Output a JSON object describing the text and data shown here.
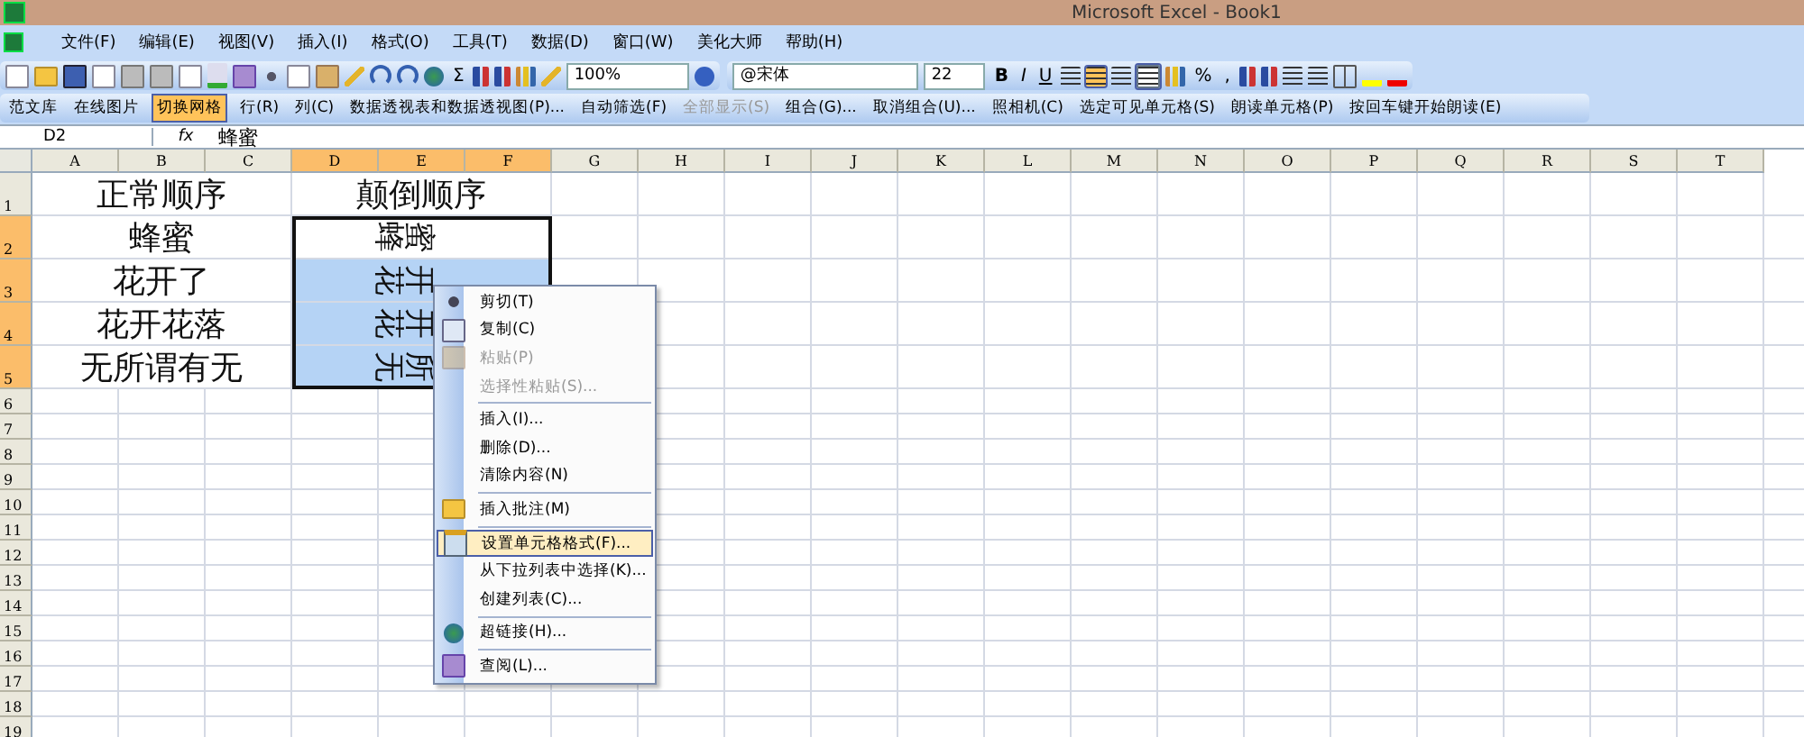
{
  "window": {
    "title": "Microsoft Excel - Book1"
  },
  "menu_bar": [
    "文件(F)",
    "编辑(E)",
    "视图(V)",
    "插入(I)",
    "格式(O)",
    "工具(T)",
    "数据(D)",
    "窗口(W)",
    "美化大师",
    "帮助(H)"
  ],
  "standard_toolbar": {
    "sum": "Σ",
    "zoom": "100%"
  },
  "formatting_toolbar": {
    "font": "@宋体",
    "size": "22",
    "bold": "B",
    "italic": "I",
    "underline": "U",
    "percent": "%",
    "comma": ",",
    "alignment": [
      {
        "selected": false
      },
      {
        "selected": true
      },
      {
        "selected": false
      }
    ],
    "merge_center": {
      "selected": true
    }
  },
  "extra_toolbar": [
    {
      "text": "范文库",
      "selected": false,
      "disabled": false
    },
    {
      "text": "在线图片",
      "selected": false,
      "disabled": false
    },
    {
      "text": "切换网格",
      "selected": true,
      "disabled": false
    },
    {
      "text": "行(R)",
      "selected": false,
      "disabled": false
    },
    {
      "text": "列(C)",
      "selected": false,
      "disabled": false
    },
    {
      "text": "数据透视表和数据透视图(P)...",
      "selected": false,
      "disabled": false
    },
    {
      "text": "自动筛选(F)",
      "selected": false,
      "disabled": false
    },
    {
      "text": "全部显示(S)",
      "selected": false,
      "disabled": true
    },
    {
      "text": "组合(G)...",
      "selected": false,
      "disabled": false
    },
    {
      "text": "取消组合(U)...",
      "selected": false,
      "disabled": false
    },
    {
      "text": "照相机(C)",
      "selected": false,
      "disabled": false
    },
    {
      "text": "选定可见单元格(S)",
      "selected": false,
      "disabled": false
    },
    {
      "text": "朗读单元格(P)",
      "selected": false,
      "disabled": false
    },
    {
      "text": "按回车键开始朗读(E)",
      "selected": false,
      "disabled": false
    }
  ],
  "formula_bar": {
    "name_box": "D2",
    "fx": "fx",
    "value": "蜂蜜"
  },
  "columns": [
    {
      "label": "A",
      "selected": false
    },
    {
      "label": "B",
      "selected": false
    },
    {
      "label": "C",
      "selected": false
    },
    {
      "label": "D",
      "selected": true
    },
    {
      "label": "E",
      "selected": true
    },
    {
      "label": "F",
      "selected": true
    },
    {
      "label": "G",
      "selected": false
    },
    {
      "label": "H",
      "selected": false
    },
    {
      "label": "I",
      "selected": false
    },
    {
      "label": "J",
      "selected": false
    },
    {
      "label": "K",
      "selected": false
    },
    {
      "label": "L",
      "selected": false
    },
    {
      "label": "M",
      "selected": false
    },
    {
      "label": "N",
      "selected": false
    },
    {
      "label": "O",
      "selected": false
    },
    {
      "label": "P",
      "selected": false
    },
    {
      "label": "Q",
      "selected": false
    },
    {
      "label": "R",
      "selected": false
    },
    {
      "label": "S",
      "selected": false
    },
    {
      "label": "T",
      "selected": false
    }
  ],
  "rows": [
    {
      "header": "1",
      "selected": false,
      "cells": [
        {
          "text": "正常顺序",
          "rotated": false,
          "selected": false
        },
        {
          "text": "颠倒顺序",
          "rotated": false,
          "selected": false
        }
      ]
    },
    {
      "header": "2",
      "selected": true,
      "cells": [
        {
          "text": "蜂蜜",
          "rotated": false,
          "selected": false
        },
        {
          "text": "蜂蜜",
          "rotated": true,
          "selected": false
        }
      ]
    },
    {
      "header": "3",
      "selected": true,
      "cells": [
        {
          "text": "花开了",
          "rotated": false,
          "selected": false
        },
        {
          "text": "花开",
          "rotated": true,
          "selected": true
        }
      ]
    },
    {
      "header": "4",
      "selected": true,
      "cells": [
        {
          "text": "花开花落",
          "rotated": false,
          "selected": false
        },
        {
          "text": "花开",
          "rotated": true,
          "selected": true
        }
      ]
    },
    {
      "header": "5",
      "selected": true,
      "cells": [
        {
          "text": "无所谓有无",
          "rotated": false,
          "selected": false
        },
        {
          "text": "无所",
          "rotated": true,
          "selected": true
        }
      ]
    },
    {
      "header": "6",
      "selected": false,
      "cells": []
    },
    {
      "header": "7",
      "selected": false,
      "cells": []
    },
    {
      "header": "8",
      "selected": false,
      "cells": []
    },
    {
      "header": "9",
      "selected": false,
      "cells": []
    },
    {
      "header": "10",
      "selected": false,
      "cells": []
    },
    {
      "header": "11",
      "selected": false,
      "cells": []
    },
    {
      "header": "12",
      "selected": false,
      "cells": []
    },
    {
      "header": "13",
      "selected": false,
      "cells": []
    },
    {
      "header": "14",
      "selected": false,
      "cells": []
    },
    {
      "header": "15",
      "selected": false,
      "cells": []
    },
    {
      "header": "16",
      "selected": false,
      "cells": []
    },
    {
      "header": "17",
      "selected": false,
      "cells": []
    },
    {
      "header": "18",
      "selected": false,
      "cells": []
    },
    {
      "header": "19",
      "selected": false,
      "cells": []
    }
  ],
  "context_menu": [
    {
      "kind": "command",
      "label": "剪切(T)",
      "disabled": false,
      "selected": false
    },
    {
      "kind": "command",
      "label": "复制(C)",
      "disabled": false,
      "selected": false
    },
    {
      "kind": "command",
      "label": "粘贴(P)",
      "disabled": true,
      "selected": false
    },
    {
      "kind": "command",
      "label": "选择性粘贴(S)...",
      "disabled": true,
      "selected": false
    },
    {
      "kind": "separator"
    },
    {
      "kind": "command",
      "label": "插入(I)...",
      "disabled": false,
      "selected": false
    },
    {
      "kind": "command",
      "label": "删除(D)...",
      "disabled": false,
      "selected": false
    },
    {
      "kind": "command",
      "label": "清除内容(N)",
      "disabled": false,
      "selected": false
    },
    {
      "kind": "separator"
    },
    {
      "kind": "command",
      "label": "插入批注(M)",
      "disabled": false,
      "selected": false
    },
    {
      "kind": "separator"
    },
    {
      "kind": "command",
      "label": "设置单元格格式(F)...",
      "disabled": false,
      "selected": true
    },
    {
      "kind": "command",
      "label": "从下拉列表中选择(K)...",
      "disabled": false,
      "selected": false
    },
    {
      "kind": "command",
      "label": "创建列表(C)...",
      "disabled": false,
      "selected": false
    },
    {
      "kind": "separator"
    },
    {
      "kind": "command",
      "label": "超链接(H)...",
      "disabled": false,
      "selected": false
    },
    {
      "kind": "separator"
    },
    {
      "kind": "command",
      "label": "查阅(L)...",
      "disabled": false,
      "selected": false
    }
  ]
}
